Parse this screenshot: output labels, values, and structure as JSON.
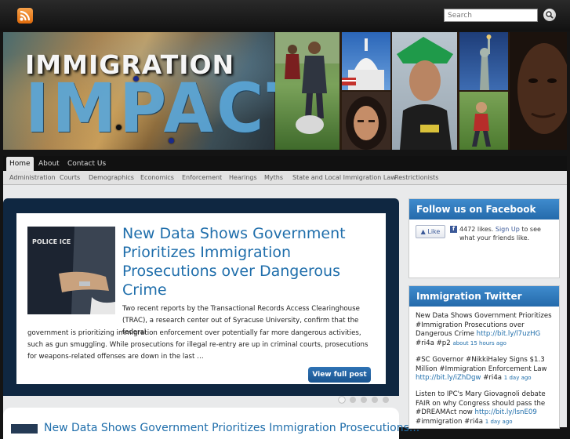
{
  "header": {
    "search_placeholder": "Search"
  },
  "banner": {
    "title_top": "IMMIGRATION",
    "title_bottom": "IMPACT"
  },
  "nav": {
    "main": [
      "Home",
      "About",
      "Contact Us"
    ],
    "categories": [
      "Administration",
      "Courts",
      "Demographics",
      "Economics",
      "Enforcement",
      "Hearings",
      "Myths",
      "State and Local Immigration Law",
      "Restrictionists"
    ]
  },
  "featured": {
    "title": "New Data Shows Government Prioritizes Immigration Prosecutions over Dangerous Crime",
    "excerpt_first": "Two recent reports by the Transactional Records Access Clearinghouse (TRAC), a research center out of Syracuse University, confirm that the federal",
    "excerpt_rest": "government is prioritizing immigration enforcement over potentially far more dangerous activities, such as gun smuggling.  While prosecutions for illegal re-entry are up in criminal courts, prosecutions for weapons-related offenses are down in the last …",
    "button_label": "View full post",
    "image_label": "POLICE ICE",
    "slide_count": 5,
    "active_slide": 1
  },
  "next_post": {
    "title": "New Data Shows Government Prioritizes Immigration Prosecutions..."
  },
  "facebook": {
    "title": "Follow us on Facebook",
    "like_label": "Like",
    "likes": "4472 likes.",
    "signup_link": "Sign Up",
    "signup_text": "to see what your friends like."
  },
  "twitter": {
    "title": "Immigration Twitter",
    "tweets": [
      {
        "text": "New Data Shows Government Prioritizes #Immigration Prosecutions over Dangerous Crime",
        "link": "http://bit.ly/l7uzHG",
        "tags": "#ri4a #p2",
        "time": "about 15 hours ago"
      },
      {
        "text": "#SC Governor #NikkiHaley Signs $1.3 Million #Immigration Enforcement Law",
        "link": "http://bit.ly/iZhDgw",
        "tags": "#ri4a",
        "time": "1 day ago"
      },
      {
        "text": "Listen to IPC's Mary Giovagnoli debate FAIR on why Congress should pass the #DREAMAct now",
        "link": "http://bit.ly/lsnE09",
        "tags": "#immigration #ri4a",
        "time": "1 day ago"
      }
    ]
  }
}
